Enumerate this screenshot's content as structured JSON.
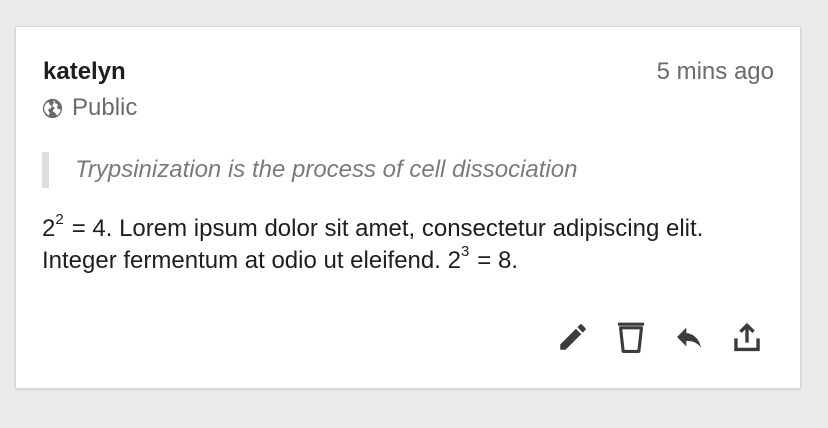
{
  "post": {
    "author": "katelyn",
    "timestamp": "5 mins ago",
    "visibility": {
      "label": "Public",
      "icon": "globe-icon"
    },
    "quote": "Trypsinization is the process of cell dissociation",
    "content": {
      "part1_base": "2",
      "part1_exp": "2",
      "part1_text": "= 4. Lorem ipsum dolor sit amet, consectetur adipiscing elit. Integer fermentum at odio ut eleifend. ",
      "part2_base": "2",
      "part2_exp": "3",
      "part2_text": "= 8."
    }
  },
  "actions": [
    {
      "name": "edit-button",
      "icon": "pencil-icon"
    },
    {
      "name": "delete-button",
      "icon": "trash-icon"
    },
    {
      "name": "reply-button",
      "icon": "reply-icon"
    },
    {
      "name": "share-button",
      "icon": "share-icon"
    }
  ],
  "colors": {
    "background": "#ebebeb",
    "card": "#ffffff",
    "text": "#1e1e1e",
    "muted": "#6b6b6b",
    "quote_border": "#dedede"
  }
}
